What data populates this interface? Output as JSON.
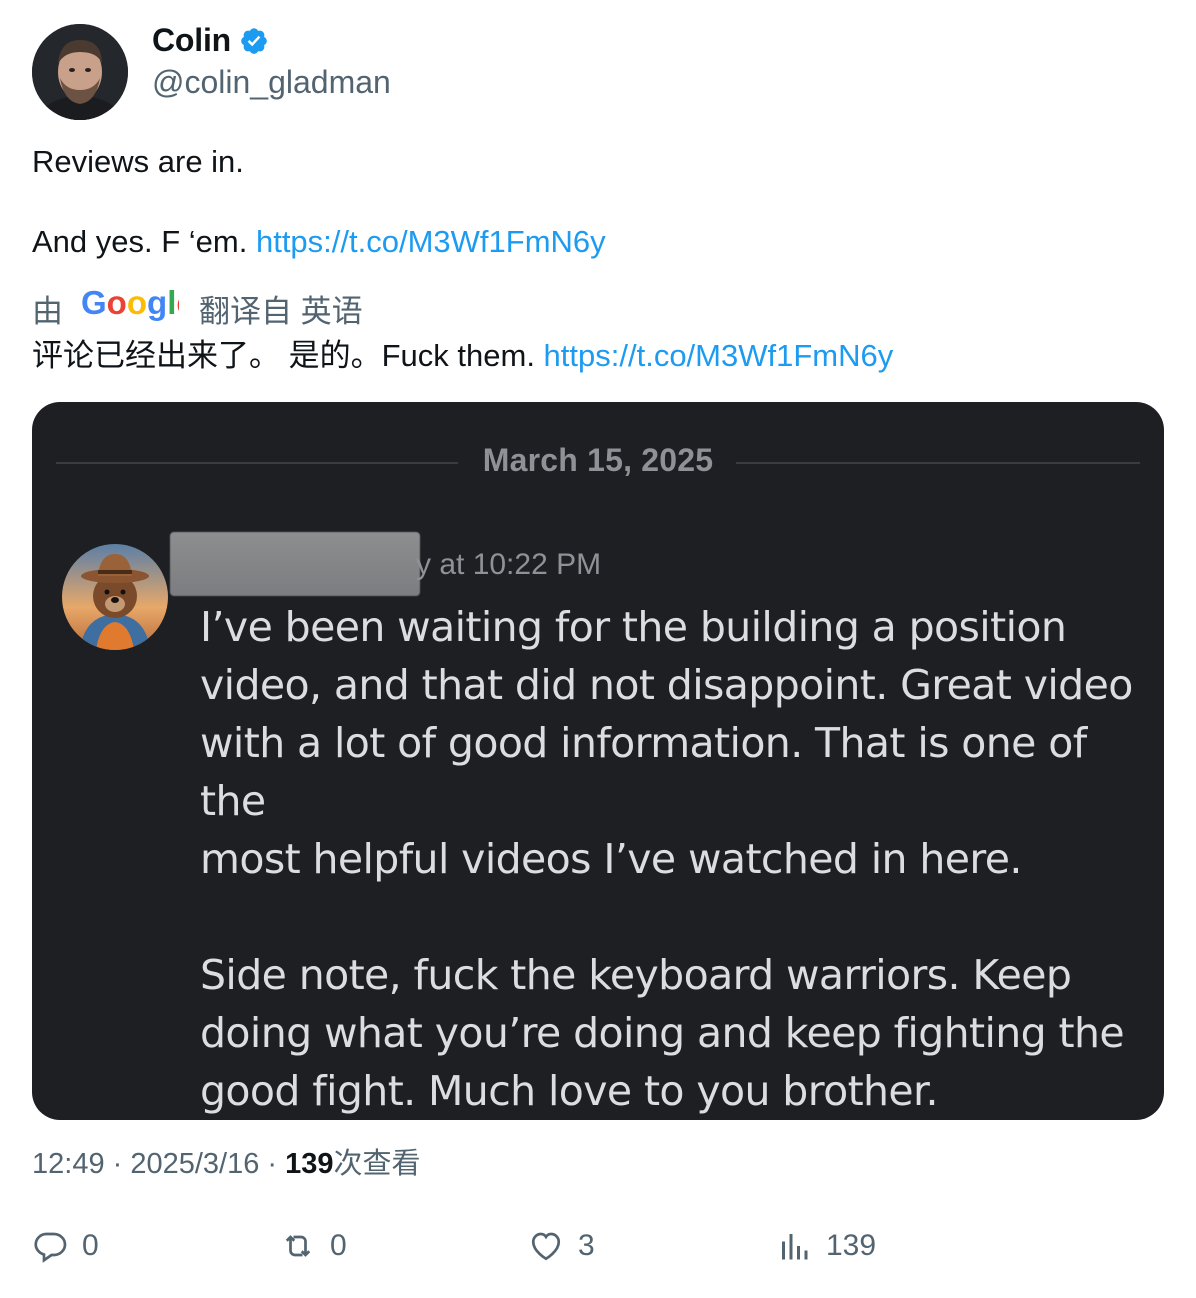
{
  "author": {
    "display_name": "Colin",
    "handle": "@colin_gladman",
    "verified": true,
    "avatar_icon": "profile-photo-man-beard"
  },
  "tweet": {
    "line1": "Reviews are in.",
    "line2_text": "And yes. F ‘em. ",
    "line2_link": "https://t.co/M3Wf1FmN6y"
  },
  "translation": {
    "prefix": "由",
    "provider": "Google",
    "suffix": "翻译自 英语",
    "text": "评论已经出来了。 是的。Fuck them. ",
    "link": "https://t.co/M3Wf1FmN6y"
  },
  "media": {
    "date_separator": "March 15, 2025",
    "timestamp": "y at 10:22 PM",
    "avatar_icon": "bear-cowboy-hat-avatar",
    "message": "I’ve been waiting for the building a position\nvideo, and that did not disappoint. Great video\nwith a lot of good information. That is one of the\nmost helpful videos I’ve watched in here.\n\nSide note, fuck the keyboard warriors. Keep\ndoing what you’re doing and keep fighting the\ngood fight. Much love to you brother."
  },
  "meta": {
    "time": "12:49",
    "sep1": " · ",
    "date": "2025/3/16",
    "sep2": " · ",
    "views_count": "139",
    "views_label": "次查看"
  },
  "actions": {
    "reply_count": "0",
    "retweet_count": "0",
    "like_count": "3",
    "views_count": "139"
  },
  "colors": {
    "link": "#1d9bf0",
    "verified": "#1d9bf0",
    "secondary_text": "#536471",
    "media_bg": "#1e1f22"
  }
}
